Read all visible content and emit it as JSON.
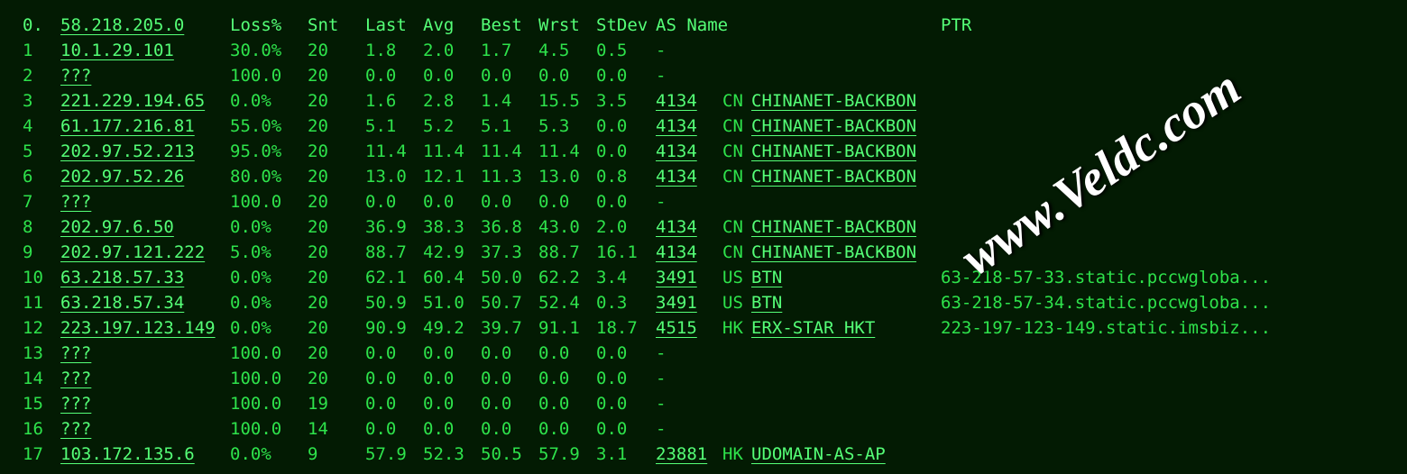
{
  "watermark": "www.Veldc.com",
  "header": {
    "hop": "0.",
    "host": "58.218.205.0",
    "loss": "Loss%",
    "snt": "Snt",
    "last": "Last",
    "avg": "Avg",
    "best": "Best",
    "wrst": "Wrst",
    "stdev": "StDev",
    "asname_label": "AS Name",
    "ptr_label": "PTR"
  },
  "rows": [
    {
      "hop": "1",
      "host": "10.1.29.101",
      "loss": "30.0%",
      "snt": "20",
      "last": "1.8",
      "avg": "2.0",
      "best": "1.7",
      "wrst": "4.5",
      "stdev": "0.5",
      "asnum": "",
      "cc": "",
      "asname": "-",
      "has_as_link": false,
      "ptr": ""
    },
    {
      "hop": "2",
      "host": "???",
      "loss": "100.0",
      "snt": "20",
      "last": "0.0",
      "avg": "0.0",
      "best": "0.0",
      "wrst": "0.0",
      "stdev": "0.0",
      "asnum": "",
      "cc": "",
      "asname": "-",
      "has_as_link": false,
      "ptr": ""
    },
    {
      "hop": "3",
      "host": "221.229.194.65",
      "loss": "0.0%",
      "snt": "20",
      "last": "1.6",
      "avg": "2.8",
      "best": "1.4",
      "wrst": "15.5",
      "stdev": "3.5",
      "asnum": "4134",
      "cc": "CN",
      "asname": "CHINANET-BACKBON",
      "has_as_link": true,
      "ptr": ""
    },
    {
      "hop": "4",
      "host": "61.177.216.81",
      "loss": "55.0%",
      "snt": "20",
      "last": "5.1",
      "avg": "5.2",
      "best": "5.1",
      "wrst": "5.3",
      "stdev": "0.0",
      "asnum": "4134",
      "cc": "CN",
      "asname": "CHINANET-BACKBON",
      "has_as_link": true,
      "ptr": ""
    },
    {
      "hop": "5",
      "host": "202.97.52.213",
      "loss": "95.0%",
      "snt": "20",
      "last": "11.4",
      "avg": "11.4",
      "best": "11.4",
      "wrst": "11.4",
      "stdev": "0.0",
      "asnum": "4134",
      "cc": "CN",
      "asname": "CHINANET-BACKBON",
      "has_as_link": true,
      "ptr": ""
    },
    {
      "hop": "6",
      "host": "202.97.52.26",
      "loss": "80.0%",
      "snt": "20",
      "last": "13.0",
      "avg": "12.1",
      "best": "11.3",
      "wrst": "13.0",
      "stdev": "0.8",
      "asnum": "4134",
      "cc": "CN",
      "asname": "CHINANET-BACKBON",
      "has_as_link": true,
      "ptr": ""
    },
    {
      "hop": "7",
      "host": "???",
      "loss": "100.0",
      "snt": "20",
      "last": "0.0",
      "avg": "0.0",
      "best": "0.0",
      "wrst": "0.0",
      "stdev": "0.0",
      "asnum": "",
      "cc": "",
      "asname": "-",
      "has_as_link": false,
      "ptr": ""
    },
    {
      "hop": "8",
      "host": "202.97.6.50",
      "loss": "0.0%",
      "snt": "20",
      "last": "36.9",
      "avg": "38.3",
      "best": "36.8",
      "wrst": "43.0",
      "stdev": "2.0",
      "asnum": "4134",
      "cc": "CN",
      "asname": "CHINANET-BACKBON",
      "has_as_link": true,
      "ptr": ""
    },
    {
      "hop": "9",
      "host": "202.97.121.222",
      "loss": "5.0%",
      "snt": "20",
      "last": "88.7",
      "avg": "42.9",
      "best": "37.3",
      "wrst": "88.7",
      "stdev": "16.1",
      "asnum": "4134",
      "cc": "CN",
      "asname": "CHINANET-BACKBON",
      "has_as_link": true,
      "ptr": ""
    },
    {
      "hop": "10",
      "host": "63.218.57.33",
      "loss": "0.0%",
      "snt": "20",
      "last": "62.1",
      "avg": "60.4",
      "best": "50.0",
      "wrst": "62.2",
      "stdev": "3.4",
      "asnum": "3491",
      "cc": "US",
      "asname": "BTN",
      "has_as_link": true,
      "ptr": "63-218-57-33.static.pccwgloba..."
    },
    {
      "hop": "11",
      "host": "63.218.57.34",
      "loss": "0.0%",
      "snt": "20",
      "last": "50.9",
      "avg": "51.0",
      "best": "50.7",
      "wrst": "52.4",
      "stdev": "0.3",
      "asnum": "3491",
      "cc": "US",
      "asname": "BTN",
      "has_as_link": true,
      "ptr": "63-218-57-34.static.pccwgloba..."
    },
    {
      "hop": "12",
      "host": "223.197.123.149",
      "loss": "0.0%",
      "snt": "20",
      "last": "90.9",
      "avg": "49.2",
      "best": "39.7",
      "wrst": "91.1",
      "stdev": "18.7",
      "asnum": "4515",
      "cc": "HK",
      "asname": "ERX-STAR HKT",
      "has_as_link": true,
      "ptr": "223-197-123-149.static.imsbiz..."
    },
    {
      "hop": "13",
      "host": "???",
      "loss": "100.0",
      "snt": "20",
      "last": "0.0",
      "avg": "0.0",
      "best": "0.0",
      "wrst": "0.0",
      "stdev": "0.0",
      "asnum": "",
      "cc": "",
      "asname": "-",
      "has_as_link": false,
      "ptr": ""
    },
    {
      "hop": "14",
      "host": "???",
      "loss": "100.0",
      "snt": "20",
      "last": "0.0",
      "avg": "0.0",
      "best": "0.0",
      "wrst": "0.0",
      "stdev": "0.0",
      "asnum": "",
      "cc": "",
      "asname": "-",
      "has_as_link": false,
      "ptr": ""
    },
    {
      "hop": "15",
      "host": "???",
      "loss": "100.0",
      "snt": "19",
      "last": "0.0",
      "avg": "0.0",
      "best": "0.0",
      "wrst": "0.0",
      "stdev": "0.0",
      "asnum": "",
      "cc": "",
      "asname": "-",
      "has_as_link": false,
      "ptr": ""
    },
    {
      "hop": "16",
      "host": "???",
      "loss": "100.0",
      "snt": "14",
      "last": "0.0",
      "avg": "0.0",
      "best": "0.0",
      "wrst": "0.0",
      "stdev": "0.0",
      "asnum": "",
      "cc": "",
      "asname": "-",
      "has_as_link": false,
      "ptr": ""
    },
    {
      "hop": "17",
      "host": "103.172.135.6",
      "loss": "0.0%",
      "snt": "9",
      "last": "57.9",
      "avg": "52.3",
      "best": "50.5",
      "wrst": "57.9",
      "stdev": "3.1",
      "asnum": "23881",
      "cc": "HK",
      "asname": "UDOMAIN-AS-AP",
      "has_as_link": true,
      "ptr": ""
    }
  ]
}
